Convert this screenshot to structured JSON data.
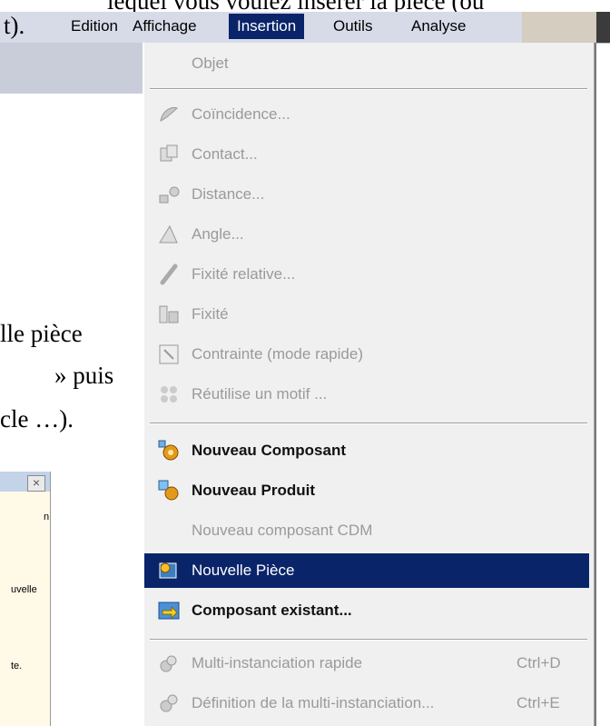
{
  "document": {
    "top_fragment": "lequel vous voulez insérer la pièce (ou",
    "line2_fragment": "t).",
    "mid_fragments": [
      "lle pièce",
      "» puis",
      "cle …)."
    ]
  },
  "menubar": {
    "items": [
      {
        "label": "Edition"
      },
      {
        "label": "Affichage"
      },
      {
        "label": "Insertion"
      },
      {
        "label": "Outils"
      },
      {
        "label": "Analyse"
      }
    ]
  },
  "dropdown": {
    "items": [
      {
        "label": "Objet",
        "state": "disabled",
        "icon": "none"
      },
      {
        "label": "Coïncidence...",
        "state": "disabled",
        "icon": "coincidence-icon"
      },
      {
        "label": "Contact...",
        "state": "disabled",
        "icon": "contact-icon"
      },
      {
        "label": "Distance...",
        "state": "disabled",
        "icon": "distance-icon"
      },
      {
        "label": "Angle...",
        "state": "disabled",
        "icon": "angle-icon"
      },
      {
        "label": "Fixité relative...",
        "state": "disabled",
        "icon": "relative-fix-icon"
      },
      {
        "label": "Fixité",
        "state": "disabled",
        "icon": "fix-icon"
      },
      {
        "label": "Contrainte (mode rapide)",
        "state": "disabled",
        "icon": "quick-constraint-icon"
      },
      {
        "label": "Réutilise un motif ...",
        "state": "disabled",
        "icon": "reuse-pattern-icon"
      },
      {
        "label": "Nouveau Composant",
        "state": "enabled",
        "icon": "new-component-icon"
      },
      {
        "label": "Nouveau Produit",
        "state": "enabled",
        "icon": "new-product-icon"
      },
      {
        "label": "Nouveau composant CDM",
        "state": "disabled",
        "icon": "none"
      },
      {
        "label": "Nouvelle Pièce",
        "state": "selected",
        "icon": "new-part-icon"
      },
      {
        "label": "Composant existant...",
        "state": "enabled",
        "icon": "existing-component-icon"
      },
      {
        "label": "Multi-instanciation rapide",
        "state": "disabled",
        "icon": "multi-instance-icon",
        "shortcut": "Ctrl+D"
      },
      {
        "label": "Définition de la multi-instanciation...",
        "state": "disabled",
        "icon": "multi-instance-def-icon",
        "shortcut": "Ctrl+E"
      }
    ]
  },
  "dialog": {
    "close_symbol": "×",
    "text_fragments": [
      "n",
      "uvelle",
      "te."
    ]
  },
  "colors": {
    "menu_highlight": "#0a246a",
    "menubar_bg": "#d7dbe8",
    "menu_bg": "#f0f0f0",
    "disabled_text": "#9a9a9a"
  }
}
